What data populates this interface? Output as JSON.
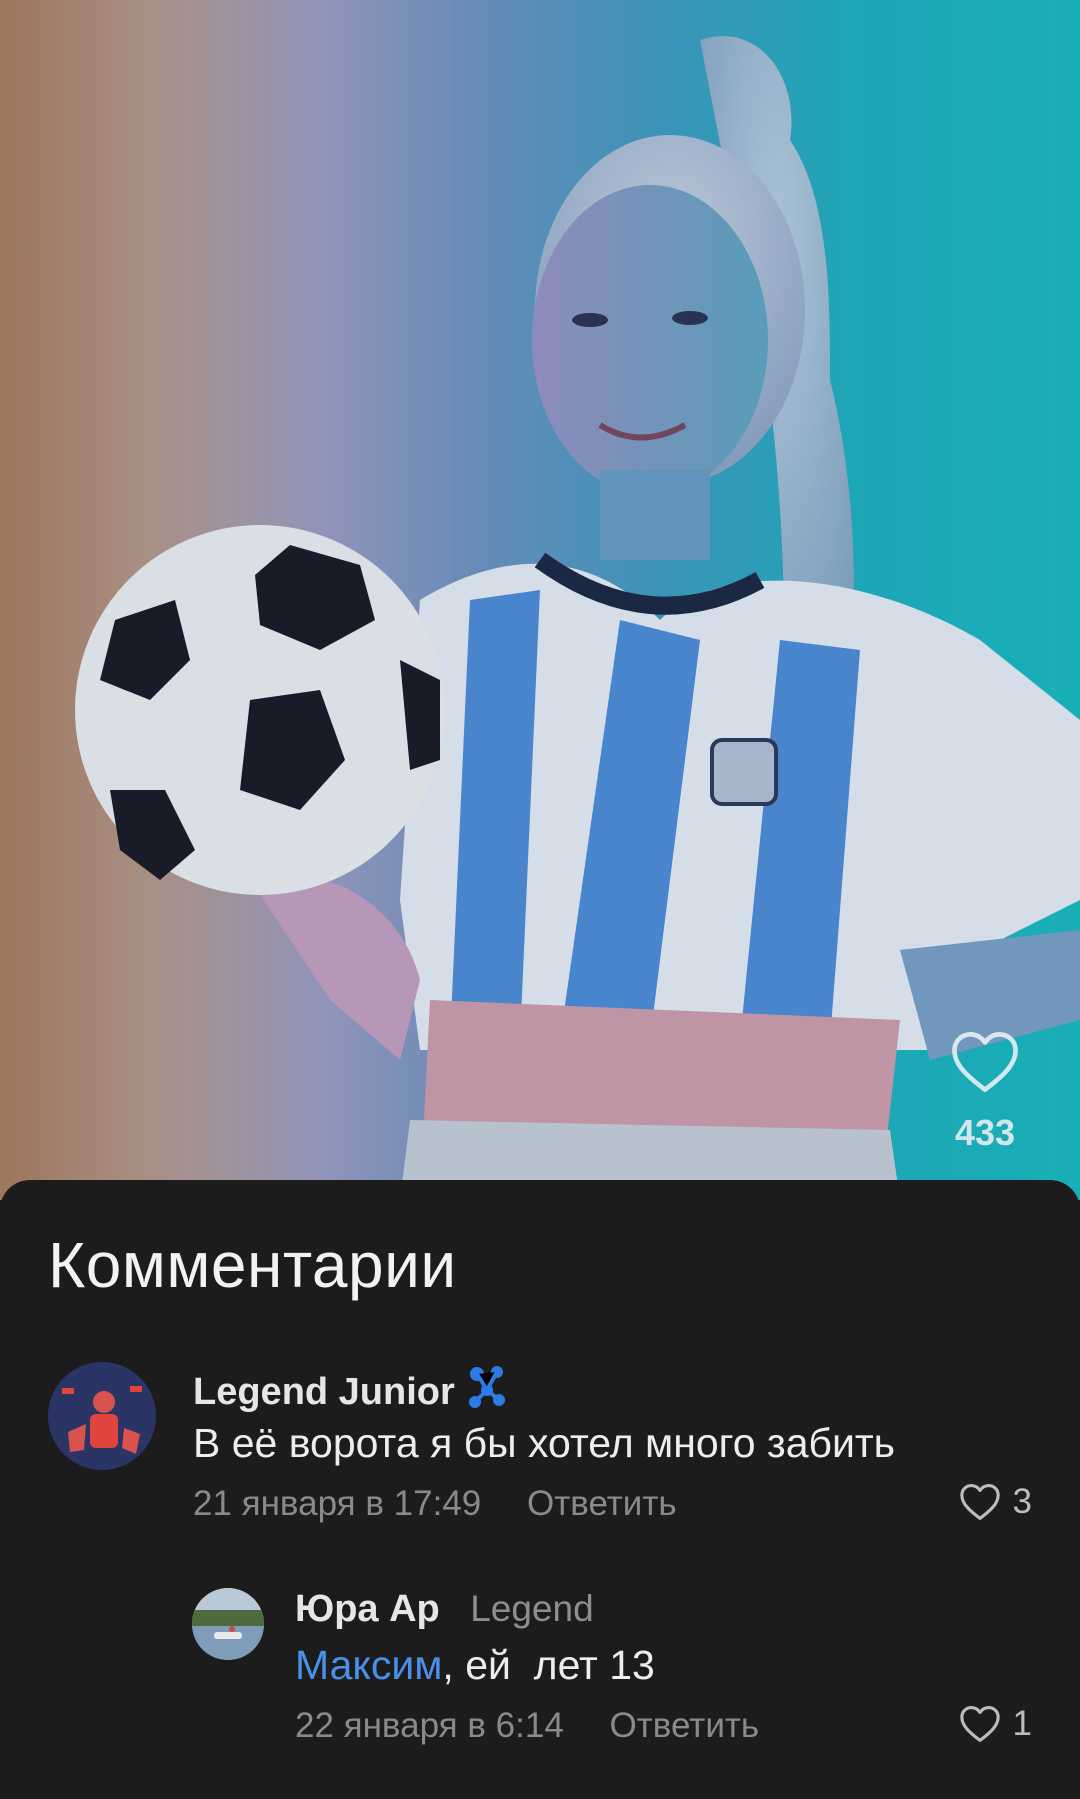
{
  "post": {
    "like_count": "433"
  },
  "comments_sheet": {
    "title": "Комментарии",
    "comments": [
      {
        "author": "Legend Junior",
        "text": "В её ворота я бы хотел много забить",
        "date": "21 января в 17:49",
        "reply_label": "Ответить",
        "likes": "3"
      },
      {
        "author": "Юра Ар",
        "badge": "Legend",
        "mention": "Максим",
        "text_rest": ", ей  лет 13",
        "date": "22 января в 6:14",
        "reply_label": "Ответить",
        "likes": "1"
      }
    ]
  },
  "colors": {
    "sheet_background": "#1c1c1d",
    "mention": "#4a90e8",
    "verified_badge": "#2f7be6",
    "secondary_text": "#8a8a8a"
  },
  "icons": {
    "like": "heart-outline-icon",
    "verified": "verified-badge-icon"
  }
}
